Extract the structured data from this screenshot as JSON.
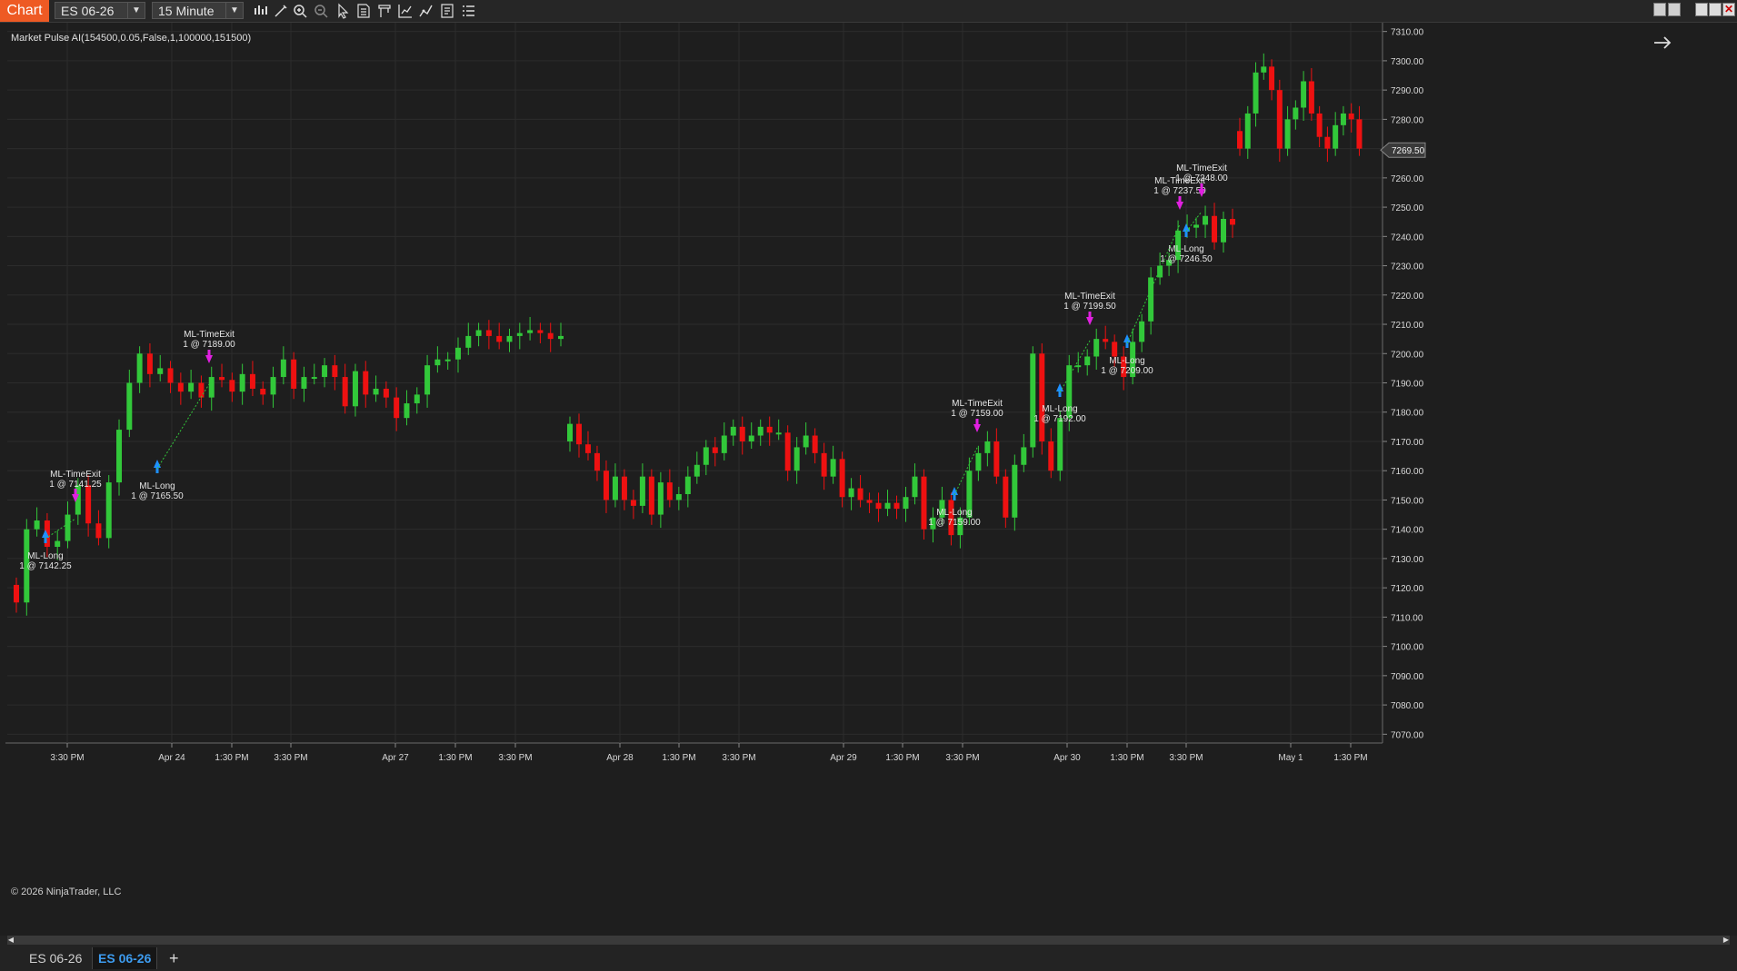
{
  "toolbar": {
    "chart_tab": "Chart",
    "instrument": "ES 06-26",
    "interval": "15 Minute",
    "icons": [
      "bar-type-icon",
      "drawing-tool-icon",
      "zoom-in-icon",
      "zoom-out-icon",
      "pointer-icon",
      "data-box-icon",
      "templates-icon",
      "indicators-icon",
      "strategies-icon",
      "properties-icon",
      "list-icon"
    ]
  },
  "chart": {
    "indicator_label": "Market Pulse AI(154500,0.05,False,1,100000,151500)",
    "copyright": "© 2026 NinjaTrader, LLC",
    "current_price": "7269.50",
    "colors": {
      "up": "#32c83a",
      "down": "#ee1111",
      "entry": "#1e90ff",
      "exit": "#e020e0",
      "bg": "#1e1e1e"
    }
  },
  "chart_data": {
    "type": "candlestick",
    "y_axis_labels": [
      "7310.00",
      "7300.00",
      "7290.00",
      "7280.00",
      "7270.00",
      "7260.00",
      "7250.00",
      "7240.00",
      "7230.00",
      "7220.00",
      "7210.00",
      "7200.00",
      "7190.00",
      "7180.00",
      "7170.00",
      "7160.00",
      "7150.00",
      "7140.00",
      "7130.00",
      "7120.00",
      "7110.00",
      "7100.00",
      "7090.00",
      "7080.00",
      "7070.00"
    ],
    "ylim": [
      7067,
      7313
    ],
    "x_axis_labels": [
      "3:30 PM",
      "Apr 24",
      "1:30 PM",
      "3:30 PM",
      "Apr 27",
      "1:30 PM",
      "3:30 PM",
      "Apr 28",
      "1:30 PM",
      "3:30 PM",
      "Apr 29",
      "1:30 PM",
      "3:30 PM",
      "Apr 30",
      "1:30 PM",
      "3:30 PM",
      "May 1",
      "1:30 PM"
    ],
    "session_close": [
      7115,
      7140,
      7143,
      7134,
      7136,
      7145,
      7155,
      7142,
      7137,
      7156,
      7174,
      7190,
      7200,
      7193,
      7195,
      7190,
      7187,
      7190,
      7185,
      7192,
      7191,
      7187,
      7193,
      7188,
      7186,
      7192,
      7198,
      7188,
      7192,
      7192,
      7196,
      7192,
      7182,
      7194,
      7186,
      7188,
      7185,
      7178,
      7183,
      7186,
      7196,
      7198,
      7198,
      7202,
      7206,
      7208,
      7206,
      7204,
      7206,
      7207,
      7208,
      7207,
      7205,
      7206,
      7176,
      7169,
      7166,
      7160,
      7150,
      7158,
      7150,
      7148,
      7158,
      7145,
      7156,
      7150,
      7152,
      7158,
      7162,
      7168,
      7166,
      7172,
      7175,
      7170,
      7172,
      7175,
      7173,
      7173,
      7160,
      7168,
      7172,
      7166,
      7158,
      7164,
      7151,
      7154,
      7150,
      7149,
      7147,
      7149,
      7147,
      7151,
      7158,
      7140,
      7144,
      7150,
      7138,
      7144,
      7160,
      7166,
      7170,
      7158,
      7144,
      7162,
      7168,
      7200,
      7170,
      7160,
      7178,
      7196,
      7196,
      7199,
      7205,
      7204,
      7199,
      7192,
      7204,
      7211,
      7226,
      7230,
      7232,
      7242,
      7243,
      7244,
      7247,
      7238,
      7246,
      7244,
      7270,
      7282,
      7296,
      7298,
      7290,
      7270,
      7280,
      7284,
      7293,
      7282,
      7274,
      7270,
      7278,
      7282,
      7280,
      7270
    ],
    "annotations": [
      {
        "label": "ML-TimeExit",
        "detail": "1 @ 7141.25"
      },
      {
        "label": "ML-Long",
        "detail": "1 @ 7142.25"
      },
      {
        "label": "ML-Long",
        "detail": "1 @ 7165.50"
      },
      {
        "label": "ML-TimeExit",
        "detail": "1 @ 7189.00"
      },
      {
        "label": "ML-TimeExit",
        "detail": "1 @ 7159.00"
      },
      {
        "label": "ML-Long",
        "detail": "1 @ 7159.00"
      },
      {
        "label": "ML-Long",
        "detail": "1 @ 7192.00"
      },
      {
        "label": "ML-TimeExit",
        "detail": "1 @ 7199.50"
      },
      {
        "label": "ML-Long",
        "detail": "1 @ 7209.00"
      },
      {
        "label": "ML-TimeExit",
        "detail": "1 @ 7237.50"
      },
      {
        "label": "ML-TimeExit",
        "detail": "1 @ 7248.00"
      },
      {
        "label": "ML-Long",
        "detail": "1 @ 7246.50"
      }
    ]
  },
  "tabs": {
    "tab1": "ES 06-26",
    "tab2": "ES 06-26",
    "add": "+"
  }
}
